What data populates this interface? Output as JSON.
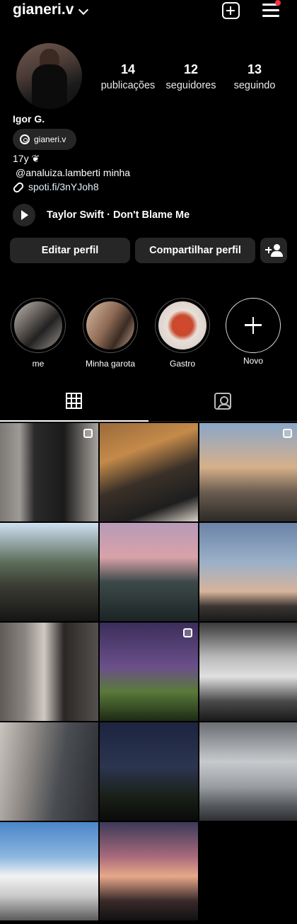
{
  "header": {
    "username": "gianeri.v"
  },
  "stats": [
    {
      "value": "14",
      "label": "publicações"
    },
    {
      "value": "12",
      "label": "seguidores"
    },
    {
      "value": "13",
      "label": "seguindo"
    }
  ],
  "profile": {
    "name": "Igor G.",
    "threads_handle": "gianeri.v",
    "bio_line1": "17y ❦",
    "bio_line2": "@analuiza.lamberti minha",
    "link": "spoti.fi/3nYJoh8"
  },
  "music": {
    "track": "Taylor Swift · Don't Blame Me"
  },
  "buttons": {
    "edit": "Editar perfil",
    "share": "Compartilhar perfil"
  },
  "highlights": [
    {
      "label": "me"
    },
    {
      "label": "Minha garota"
    },
    {
      "label": "Gastro"
    },
    {
      "label": "Novo"
    }
  ],
  "colors": {
    "background": "#000000",
    "button": "#262626",
    "notification_dot": "#ff3040"
  },
  "icons": [
    "chevron-down-icon",
    "new-post-icon",
    "menu-icon",
    "threads-icon",
    "link-icon",
    "play-icon",
    "add-user-icon",
    "plus-icon",
    "grid-icon",
    "tagged-icon",
    "multi-photo-icon"
  ]
}
